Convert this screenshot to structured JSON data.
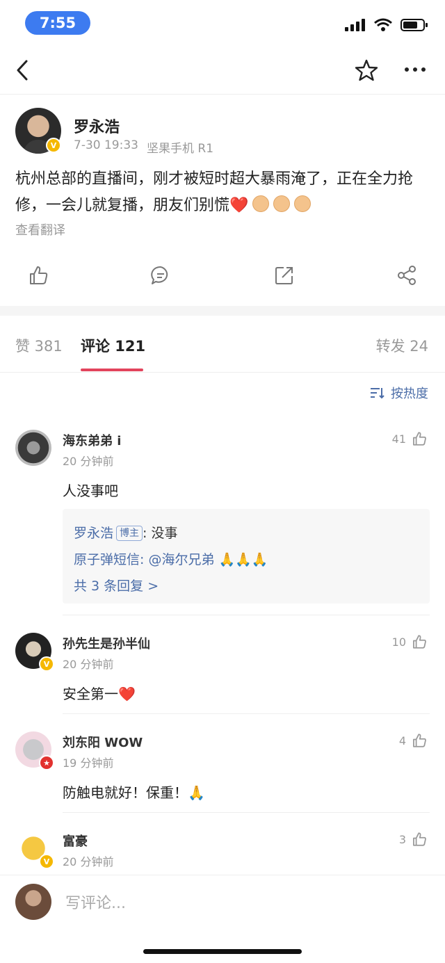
{
  "status_bar": {
    "time": "7:55"
  },
  "nav": {
    "back_icon": "chevron-left-icon",
    "star_icon": "star-icon",
    "more_icon": "more-icon"
  },
  "post": {
    "author": "罗永浩",
    "date": "7-30 19:33",
    "device": "坚果手机 R1",
    "text": "杭州总部的直播间，刚才被短时超大暴雨淹了，正在全力抢修，一会儿就复播，朋友们别慌",
    "heart": "❤️",
    "translate": "查看翻译"
  },
  "tabs": {
    "likes": "赞 381",
    "comments": "评论 121",
    "reposts": "转发 24"
  },
  "sort": {
    "label": "按热度"
  },
  "comments": [
    {
      "name": "海东弟弟 i",
      "time": "20 分钟前",
      "text": "人没事吧",
      "likes": "41",
      "replies": {
        "reply1_name": "罗永浩",
        "reply1_badge": "博主",
        "reply1_text": ": 没事",
        "reply2_name": "原子弹短信:",
        "reply2_text": "@海尔兄弟",
        "reply2_emoji": "🙏🙏🙏",
        "more": "共 3 条回复 >"
      }
    },
    {
      "name": "孙先生是孙半仙",
      "time": "20 分钟前",
      "text": "安全第一",
      "emoji": "❤️",
      "likes": "10"
    },
    {
      "name": "刘东阳 WOW",
      "time": "19 分钟前",
      "text": "防触电就好！保重！",
      "emoji": "🙏",
      "likes": "4"
    },
    {
      "name": "富豪",
      "time": "20 分钟前",
      "text": "",
      "likes": "3"
    }
  ],
  "comment_input": {
    "placeholder": "写评论..."
  },
  "colors": {
    "accent": "#e2445c",
    "link": "#4b6da8",
    "time_pill": "#3d7bf0",
    "verified": "#f5b800"
  }
}
